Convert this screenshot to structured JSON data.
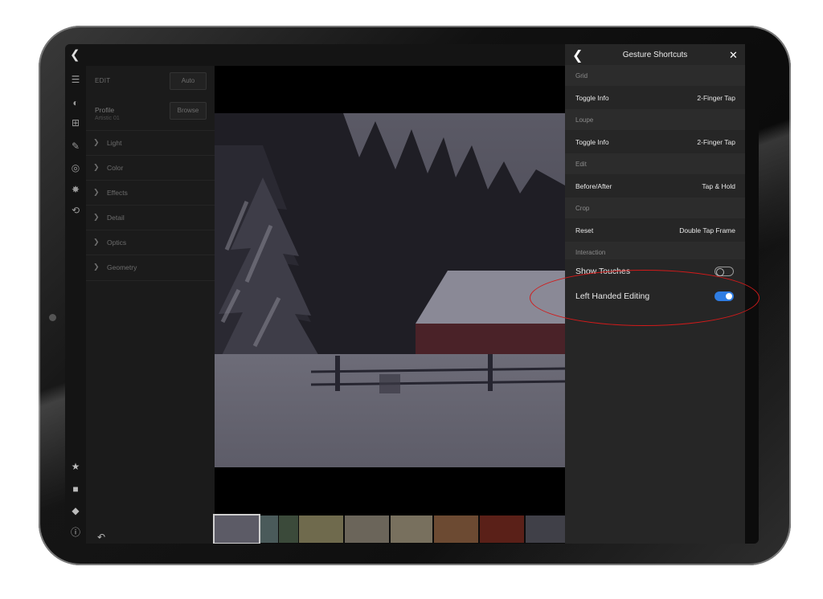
{
  "panel": {
    "title": "Gesture Shortcuts",
    "groups": [
      {
        "header": "Grid",
        "rows": [
          {
            "label": "Toggle Info",
            "value": "2-Finger Tap"
          }
        ]
      },
      {
        "header": "Loupe",
        "rows": [
          {
            "label": "Toggle Info",
            "value": "2-Finger Tap"
          }
        ]
      },
      {
        "header": "Edit",
        "rows": [
          {
            "label": "Before/After",
            "value": "Tap & Hold"
          }
        ]
      },
      {
        "header": "Crop",
        "rows": [
          {
            "label": "Reset",
            "value": "Double Tap Frame"
          }
        ]
      },
      {
        "header": "Interaction",
        "rows": [
          {
            "label": "Show Touches",
            "toggle": "off"
          },
          {
            "label": "Left Handed Editing",
            "toggle": "on"
          }
        ]
      }
    ]
  },
  "edit_panel": {
    "header": "EDIT",
    "auto_label": "Auto",
    "profile_title": "Profile",
    "profile_name": "Artistic 01",
    "browse_label": "Browse",
    "sections": [
      "Light",
      "Color",
      "Effects",
      "Detail",
      "Optics",
      "Geometry"
    ]
  },
  "colors": {
    "accent_toggle": "#2f7de3",
    "annotation": "#d21a1a"
  }
}
